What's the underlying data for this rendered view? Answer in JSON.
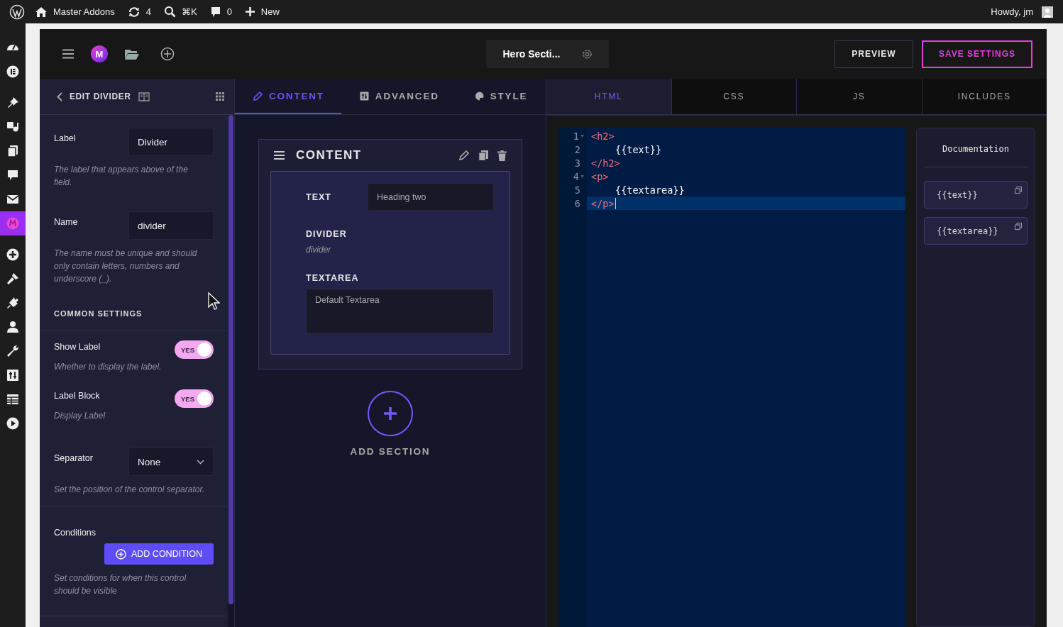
{
  "admin_bar": {
    "site": "Master Addons",
    "updates": "4",
    "search_shortcut": "⌘K",
    "comments": "0",
    "new": "New",
    "greeting": "Howdy, jm"
  },
  "admin_menu": [
    {
      "kind": "gauge",
      "selected": false
    },
    {
      "kind": "elementor",
      "selected": false
    },
    {
      "kind": "pin",
      "selected": false
    },
    {
      "kind": "media",
      "selected": false
    },
    {
      "kind": "pages",
      "selected": false
    },
    {
      "kind": "comment",
      "selected": false
    },
    {
      "kind": "mail",
      "selected": false
    },
    {
      "kind": "brand",
      "selected": true
    },
    {
      "kind": "plus",
      "selected": false
    },
    {
      "kind": "brush",
      "selected": false
    },
    {
      "kind": "plug",
      "selected": false
    },
    {
      "kind": "user",
      "selected": false
    },
    {
      "kind": "wrench",
      "selected": false
    },
    {
      "kind": "sliders",
      "selected": false
    },
    {
      "kind": "table",
      "selected": false
    },
    {
      "kind": "play",
      "selected": false
    }
  ],
  "header": {
    "logo": "M",
    "template_name": "Hero Secti...",
    "preview": "PREVIEW",
    "save": "SAVE SETTINGS"
  },
  "control_panel": {
    "title": "EDIT DIVIDER",
    "controls": [
      {
        "kind": "input",
        "label": "Label",
        "value": "Divider",
        "help": "The label that appears above of the field."
      },
      {
        "kind": "input",
        "label": "Name",
        "value": "divider",
        "help": "The name must be unique and should only contain letters, numbers and underscore (_)."
      },
      {
        "kind": "heading",
        "label": "COMMON SETTINGS"
      },
      {
        "kind": "toggle",
        "label": "Show Label",
        "help": "Whether to display the label.",
        "on": true,
        "state_text": "YES"
      },
      {
        "kind": "toggle",
        "label": "Label Block",
        "help": "Display Label",
        "on": true,
        "state_text": "YES"
      },
      {
        "kind": "select",
        "label": "Separator",
        "value": "None",
        "help": "Set the position of the control separator."
      },
      {
        "kind": "button",
        "label": "Conditions",
        "value": "ADD CONDITION",
        "help": "Set conditions for when this control should be visible"
      }
    ]
  },
  "builder": {
    "tabs": [
      {
        "label": "CONTENT",
        "selected": true
      },
      {
        "label": "ADVANCED",
        "selected": false
      },
      {
        "label": "STYLE",
        "selected": false
      }
    ],
    "section": {
      "title": "CONTENT",
      "fields": [
        {
          "kind": "input",
          "label": "TEXT",
          "value": "Heading two"
        },
        {
          "kind": "divider",
          "label": "DIVIDER",
          "value": "divider"
        },
        {
          "kind": "textarea",
          "label": "TEXTAREA",
          "value": "Default Textarea"
        }
      ]
    },
    "add_section": "ADD SECTION"
  },
  "code": {
    "tabs": [
      {
        "label": "HTML",
        "selected": true
      },
      {
        "label": "CSS",
        "selected": false
      },
      {
        "label": "JS",
        "selected": false
      },
      {
        "label": "INCLUDES",
        "selected": false
      }
    ],
    "lines": [
      {
        "number": "1",
        "text": "<h2>",
        "kind": "tag",
        "indented": false,
        "foldable": true,
        "active": false
      },
      {
        "number": "2",
        "text": "{{text}}",
        "kind": "text",
        "indented": true,
        "foldable": false,
        "active": false
      },
      {
        "number": "3",
        "text": "</h2>",
        "kind": "tag",
        "indented": false,
        "foldable": false,
        "active": false
      },
      {
        "number": "4",
        "text": "<p>",
        "kind": "tag",
        "indented": false,
        "foldable": true,
        "active": false
      },
      {
        "number": "5",
        "text": "{{textarea}}",
        "kind": "text",
        "indented": true,
        "foldable": false,
        "active": false
      },
      {
        "number": "6",
        "text": "</p>",
        "kind": "tag",
        "indented": false,
        "foldable": false,
        "active": true
      }
    ],
    "documentation": {
      "title": "Documentation",
      "items": [
        "{{text}}",
        "{{textarea}}"
      ]
    }
  }
}
